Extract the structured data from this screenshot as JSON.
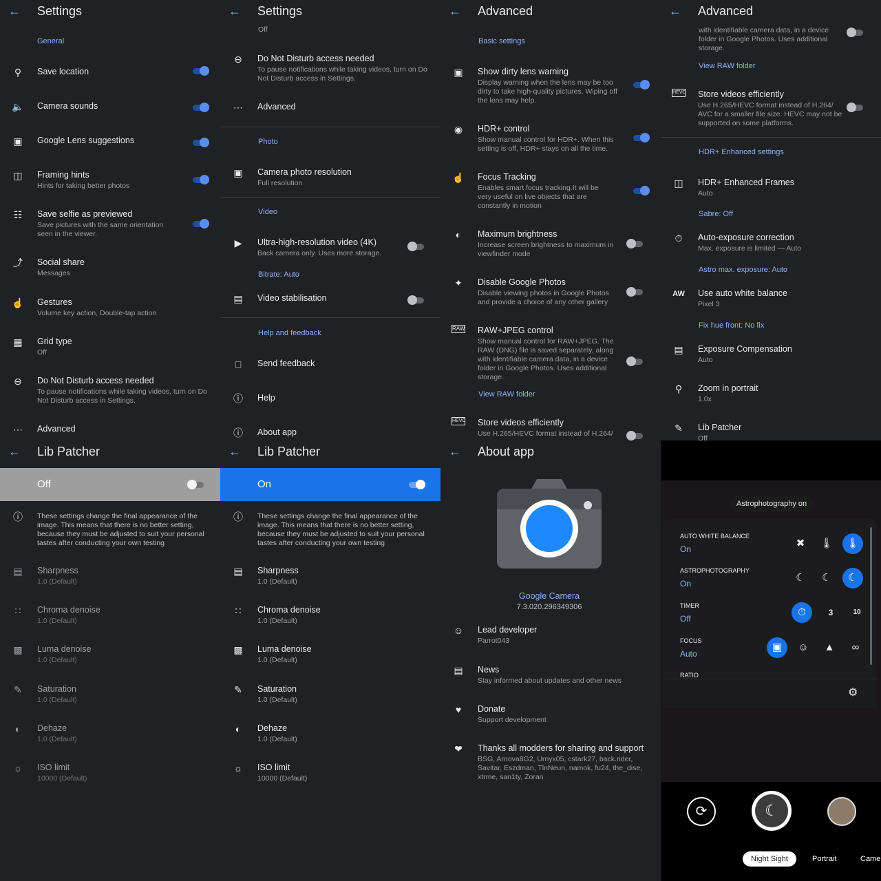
{
  "p1": {
    "title": "Settings",
    "section_general": "General",
    "items": [
      {
        "title": "Save location",
        "icon": "location-pin-icon"
      },
      {
        "title": "Camera sounds",
        "icon": "speaker-icon"
      },
      {
        "title": "Google Lens suggestions",
        "icon": "lens-icon"
      },
      {
        "title": "Framing hints",
        "sub": "Hints for taking better photos",
        "icon": "frame-icon"
      },
      {
        "title": "Save selfie as previewed",
        "sub": "Save pictures with the same orientation seen in the viewer.",
        "icon": "selfie-icon"
      },
      {
        "title": "Social share",
        "sub": "Messages",
        "icon": "share-icon"
      },
      {
        "title": "Gestures",
        "sub": "Volume key action, Double-tap action",
        "icon": "gesture-icon"
      },
      {
        "title": "Grid type",
        "sub": "Off",
        "icon": "grid-icon"
      },
      {
        "title": "Do Not Disturb access needed",
        "sub": "To pause notifications while taking videos, turn on Do Not Disturb access in Settings.",
        "icon": "dnd-icon"
      },
      {
        "title": "Advanced",
        "icon": "more-icon"
      }
    ]
  },
  "p2": {
    "title": "Settings",
    "top_off": "Off",
    "dnd_title": "Do Not Disturb access needed",
    "dnd_sub": "To pause notifications while taking videos, turn on Do Not Disturb access in Settings.",
    "advanced": "Advanced",
    "section_photo": "Photo",
    "photo_res_title": "Camera photo resolution",
    "photo_res_sub": "Full resolution",
    "section_video": "Video",
    "uhd_title": "Ultra-high-resolution video (4K)",
    "uhd_sub": "Back camera only. Uses more storage.",
    "bitrate": "Bitrate: Auto",
    "stab_title": "Video stabilisation",
    "section_help": "Help and feedback",
    "send_feedback": "Send feedback",
    "help": "Help",
    "about": "About app"
  },
  "p3": {
    "title": "Advanced",
    "section_basic": "Basic settings",
    "dirty_title": "Show dirty lens warning",
    "dirty_sub": "Display warning when the lens may be too dirty to take high-quality pictures. Wiping off the lens may help.",
    "hdr_title": "HDR+ control",
    "hdr_sub": "Show manual control for HDR+. When this setting is off, HDR+ stays on all the time.",
    "focus_title": "Focus Tracking",
    "focus_sub": "Enables smart focus tracking.It will be very useful on live objects that are constantly in motion",
    "bright_title": "Maximum brightness",
    "bright_sub": "Increase screen brightness to maximum in viewfinder mode",
    "gphotos_title": "Disable Google Photos",
    "gphotos_sub": "Disable viewing photos in Google Photos and provide a choice of any other gallery",
    "raw_title": "RAW+JPEG control",
    "raw_sub": "Show manual control for RAW+JPEG. The RAW (DNG) file is saved separately, along with identifiable camera data, in a device folder in Google Photos. Uses additional storage.",
    "raw_link": "View RAW folder",
    "hevc_title": "Store videos efficiently",
    "hevc_sub": "Use H.265/HEVC format instead of H.264/"
  },
  "p4": {
    "title": "Advanced",
    "top_sub": "with identifiable camera data, in a device folder in Google Photos. Uses additional storage.",
    "raw_link": "View RAW folder",
    "hevc_title": "Store videos efficiently",
    "hevc_sub": "Use H.265/HEVC format instead of H.264/ AVC for a smaller file size. HEVC may not be supported on some platforms.",
    "section_hdr": "HDR+ Enhanced settings",
    "frames_title": "HDR+ Enhanced Frames",
    "frames_sub": "Auto",
    "sabre": "Sabre: Off",
    "aec_title": "Auto-exposure correction",
    "aec_sub": "Max. exposure is limited — Auto",
    "astro": "Astro max. exposure: Auto",
    "awb_title": "Use auto white balance",
    "awb_sub": "Pixel 3",
    "hue": "Fix hue front: No fix",
    "ec_title": "Exposure Compensation",
    "ec_sub": "Auto",
    "zoom_title": "Zoom in portrait",
    "zoom_sub": "1.0x",
    "lib_title": "Lib Patcher",
    "lib_sub": "Off"
  },
  "lib": {
    "title": "Lib Patcher",
    "off_label": "Off",
    "on_label": "On",
    "info": "These settings change the final appearance of the image. This means that there is no better setting, because they must be adjusted to suit your personal tastes after conducting your own testing",
    "items": [
      {
        "title": "Sharpness",
        "sub": "1.0 (Default)",
        "icon": "ruler-icon"
      },
      {
        "title": "Chroma denoise",
        "sub": "1.0 (Default)",
        "icon": "chroma-icon"
      },
      {
        "title": "Luma denoise",
        "sub": "1.0 (Default)",
        "icon": "luma-icon"
      },
      {
        "title": "Saturation",
        "sub": "1.0 (Default)",
        "icon": "dropper-icon"
      },
      {
        "title": "Dehaze",
        "sub": "1.0 (Default)",
        "icon": "dehaze-icon"
      },
      {
        "title": "ISO limit",
        "sub": "10000 (Default)",
        "icon": "iso-icon"
      }
    ]
  },
  "about": {
    "title": "About app",
    "app_name": "Google Camera",
    "version": "7.3.020.296349306",
    "lead_title": "Lead developer",
    "lead_sub": "Parrot043",
    "news_title": "News",
    "news_sub": "Stay informed about updates and other news",
    "donate_title": "Donate",
    "donate_sub": "Support development",
    "thanks_title": "Thanks all modders for sharing and support",
    "thanks_sub": "BSG, Arnova8G2, Urnyx05, cstark27, back.rider, Savitar, Eszdman, TlnNeun, namok, fu24, the_dise, xtrme, san1ty, Zoran"
  },
  "cam": {
    "chip": "Astrophotography on",
    "awb_label": "AUTO WHITE BALANCE",
    "awb_value": "On",
    "astro_label": "ASTROPHOTOGRAPHY",
    "astro_value": "On",
    "timer_label": "TIMER",
    "timer_value": "Off",
    "focus_label": "FOCUS",
    "focus_value": "Auto",
    "ratio_label": "RATIO",
    "mode_night": "Night Sight",
    "mode_portrait": "Portrait",
    "mode_camera": "Came",
    "timer3": "3",
    "timer10": "10"
  },
  "colors": {
    "accent": "#8ab4f8",
    "toggle_on": "#5b8def",
    "lib_on_bar": "#1a73e8",
    "lib_off_bar": "#9e9e9e",
    "bg": "#202124"
  }
}
